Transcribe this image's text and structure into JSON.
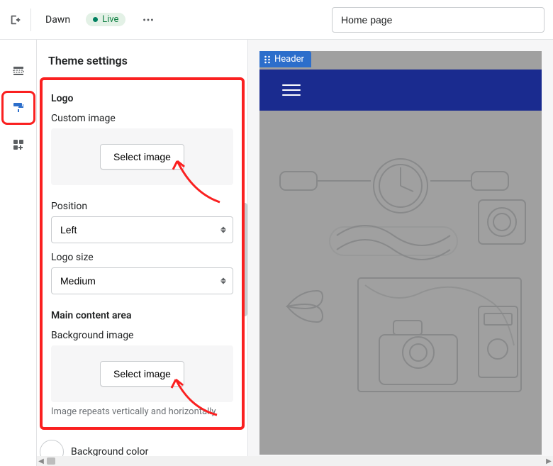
{
  "topbar": {
    "theme_name": "Dawn",
    "status_label": "Live",
    "page_value": "Home page"
  },
  "panel": {
    "title": "Theme settings",
    "logo": {
      "section_label": "Logo",
      "custom_image_label": "Custom image",
      "select_image_label": "Select image",
      "position_label": "Position",
      "position_value": "Left",
      "size_label": "Logo size",
      "size_value": "Medium"
    },
    "main_content": {
      "section_label": "Main content area",
      "bg_image_label": "Background image",
      "select_image_label": "Select image",
      "repeat_note": "Image repeats vertically and horizontally",
      "bg_color_label": "Background color"
    }
  },
  "preview": {
    "header_tag": "Header"
  },
  "icons": {
    "exit": "exit-icon",
    "sections": "sections-icon",
    "theme_settings": "paint-roller-icon",
    "apps": "apps-icon",
    "more": "more-horizontal-icon",
    "drag": "drag-handle-icon"
  }
}
